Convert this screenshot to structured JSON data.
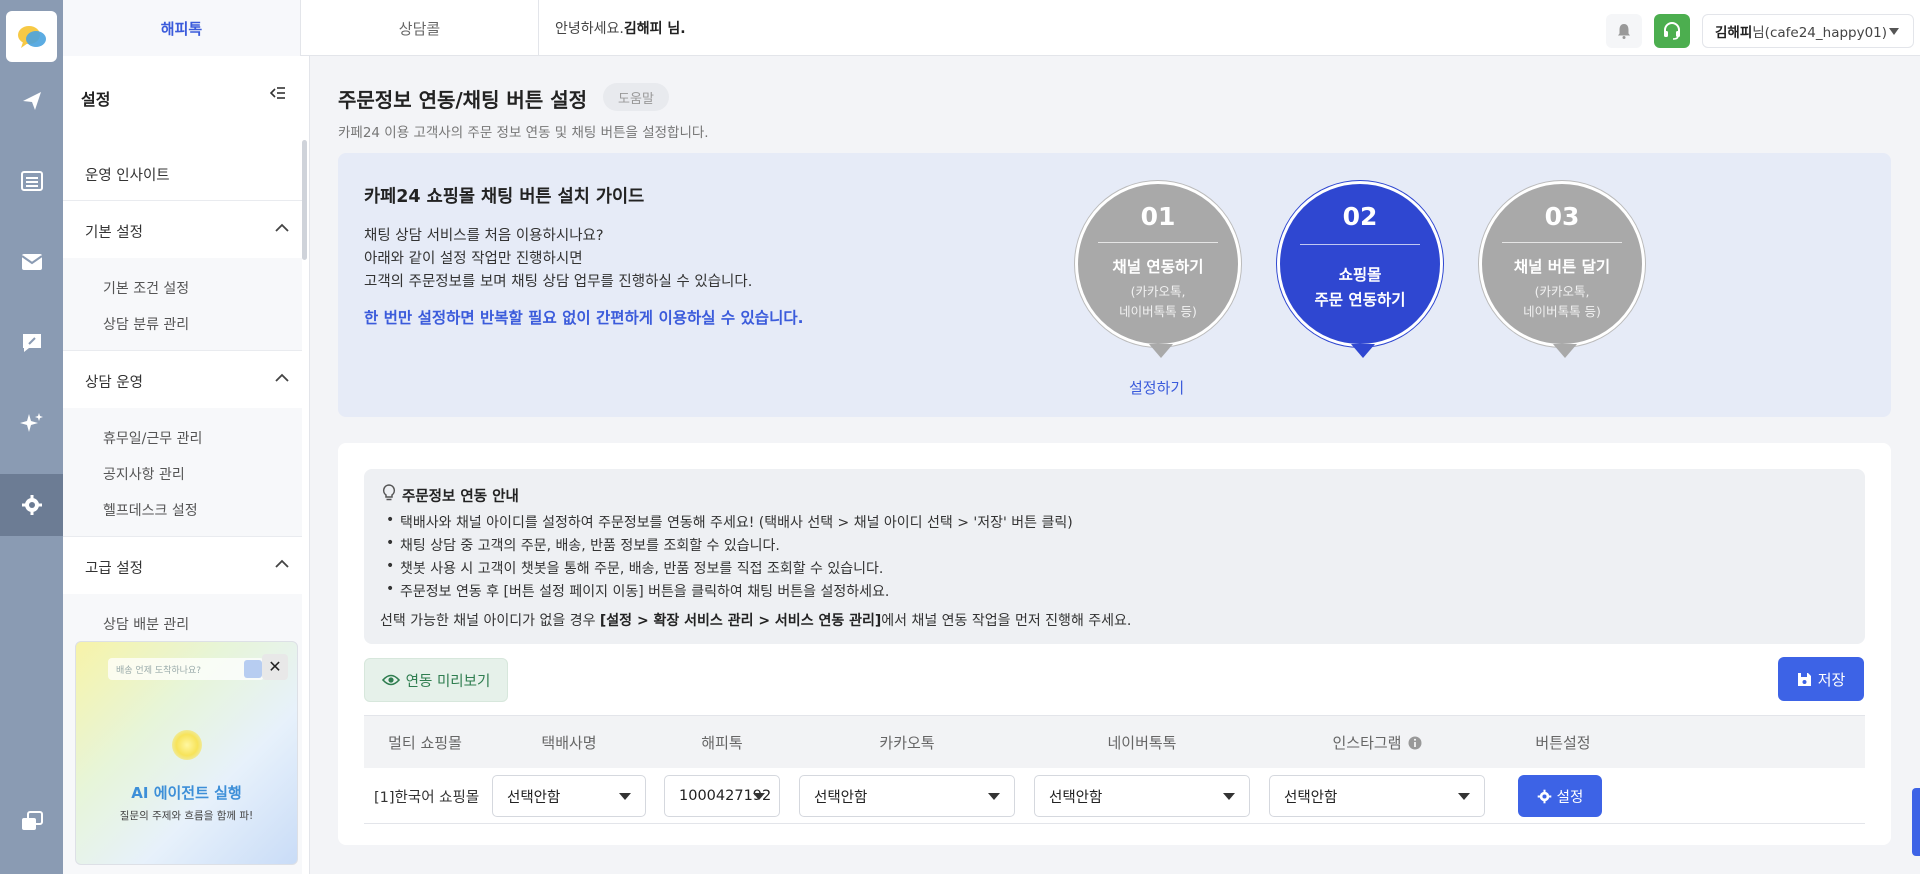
{
  "topbar": {
    "tabs": [
      {
        "label": "해피톡"
      },
      {
        "label": "상담콜"
      }
    ],
    "greeting_prefix": "안녕하세요.",
    "greeting_name": "김해피 님.",
    "user_name": "김해피",
    "user_suffix": "님(cafe24_happy01)"
  },
  "rail": {
    "icons": [
      "logo-icon",
      "send-icon",
      "list-icon",
      "mail-icon",
      "chat-icon",
      "sparkle-icon",
      "settings-icon",
      "window-icon"
    ],
    "active": "settings-icon",
    "colors": {
      "rail_bg": "#8a9bb3",
      "active_bg": "#6c7c94"
    }
  },
  "sidebar": {
    "title": "설정",
    "top_item": "운영 인사이트",
    "sections": [
      {
        "label": "기본 설정",
        "items": [
          "기본 조건 설정",
          "상담 분류 관리"
        ]
      },
      {
        "label": "상담 운영",
        "items": [
          "휴무일/근무 관리",
          "공지사항 관리",
          "헬프데스크 설정"
        ]
      },
      {
        "label": "고급 설정",
        "items": [
          "상담 배분 관리"
        ]
      }
    ],
    "promo": {
      "placeholder": "배송 언제 도착하나요?",
      "title": "AI 에이전트 실행",
      "subtitle": "질문의 주제와 흐름을 함께 파!",
      "close": "✕"
    }
  },
  "main": {
    "title": "주문정보 연동/채팅 버튼 설정",
    "help_label": "도움말",
    "description": "카페24 이용 고객사의 주문 정보 연동 및 채팅 버튼을 설정합니다.",
    "guide": {
      "title": "카페24 쇼핑몰 채팅 버튼 설치 가이드",
      "lines": [
        "채팅 상담 서비스를 처음 이용하시나요?",
        "아래와 같이 설정 작업만 진행하시면",
        "고객의 주문정보를 보며 채팅 상담 업무를 진행하실 수 있습니다."
      ],
      "highlight": "한 번만 설정하면 반복할 필요 없이 간편하게 이용하실 수 있습니다.",
      "steps": [
        {
          "num": "01",
          "name": "채널 연동하기",
          "note1": "(카카오톡,",
          "note2": "네이버톡톡 등)"
        },
        {
          "num": "02",
          "name1": "쇼핑몰",
          "name2": "주문 연동하기"
        },
        {
          "num": "03",
          "name": "채널 버튼 달기",
          "note1": "(카카오톡,",
          "note2": "네이버톡톡 등)"
        }
      ],
      "setup_link": "설정하기"
    },
    "notice": {
      "title": "주문정보 연동 안내",
      "bullets": [
        "택배사와 채널 아이디를 설정하여 주문정보를 연동해 주세요! (택배사 선택 > 채널 아이디 선택 > '저장' 버튼 클릭)",
        "채팅 상담 중 고객의 주문, 배송, 반품 정보를 조회할 수 있습니다.",
        "챗봇 사용 시 고객이 챗봇을 통해 주문, 배송, 반품 정보를 직접 조회할 수 있습니다.",
        "주문정보 연동 후 [버튼 설정 페이지 이동] 버튼을 클릭하여 채팅 버튼을 설정하세요."
      ],
      "footer_prefix": "선택 가능한 채널 아이디가 없을 경우 ",
      "footer_bold": "[설정 > 확장 서비스 관리 > 서비스 연동 관리]",
      "footer_suffix": "에서 채널 연동 작업을 먼저 진행해 주세요."
    },
    "preview_label": "연동 미리보기",
    "save_label": "저장",
    "table": {
      "headers": [
        "멀티 쇼핑몰",
        "택배사명",
        "해피톡",
        "카카오톡",
        "네이버톡톡",
        "인스타그램",
        "버튼설정"
      ],
      "rows": [
        {
          "mall": "[1]한국어 쇼핑몰",
          "courier": "선택안함",
          "happytalk": "1000427192",
          "kakao": "선택안함",
          "naver": "선택안함",
          "instagram": "선택안함",
          "button": "설정"
        }
      ]
    },
    "colors": {
      "primary": "#3d63e6",
      "step_active": "#2f47d1",
      "step_inactive": "#a9a9a9",
      "guide_bg": "#e6ebf7",
      "preview_green": "#2e7d4f"
    }
  }
}
